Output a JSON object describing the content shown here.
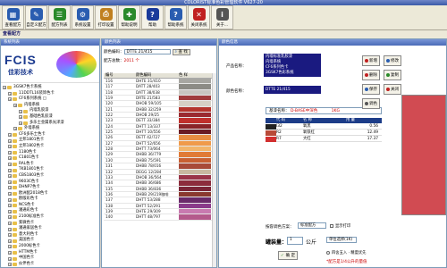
{
  "window": {
    "title": "COLORIST标准色彩管理软件 V627-20"
  },
  "toolbar": [
    {
      "label": "查看配方",
      "color": "#2a5db0",
      "icon": "view"
    },
    {
      "label": "自定义配方",
      "color": "#2a5db0",
      "icon": "custom"
    },
    {
      "label": "配方列表",
      "color": "#2a8a2a",
      "icon": "list"
    },
    {
      "label": "系统设置",
      "color": "#2a5db0",
      "icon": "settings"
    },
    {
      "label": "打印设置",
      "color": "#c08020",
      "icon": "print"
    },
    {
      "label": "帮助说明",
      "color": "#2a8a2a",
      "icon": "help"
    },
    {
      "label": "帮助",
      "color": "#1a3a9a",
      "icon": "question"
    },
    {
      "label": "帮助系统",
      "color": "#2a5db0",
      "icon": "question"
    },
    {
      "label": "关闭系统",
      "color": "#c02020",
      "icon": "close"
    },
    {
      "label": "关于...",
      "color": "#555555",
      "icon": "about"
    }
  ],
  "strip": {
    "title": "查看配方"
  },
  "left": {
    "header": "系统列表",
    "logo_text": "FCIS",
    "logo_sub": "佳彩技术",
    "tree": [
      {
        "indent": 0,
        "label": "3GSK7色卡系统"
      },
      {
        "indent": 1,
        "label": "11DDTL16装饰色卡"
      },
      {
        "indent": 1,
        "label": "CF6系列系统 □"
      },
      {
        "indent": 2,
        "label": "内墙系统"
      },
      {
        "indent": 3,
        "label": "内墙乳胶漆"
      },
      {
        "indent": 3,
        "label": "基础色乳胶漆"
      },
      {
        "indent": 3,
        "label": "多乐士金属系光泽漆"
      },
      {
        "indent": 2,
        "label": "外墙系统"
      },
      {
        "indent": 1,
        "label": "CF6多乐士色卡"
      },
      {
        "indent": 1,
        "label": "立邦1801色卡"
      },
      {
        "indent": 1,
        "label": "立邦1802色卡"
      },
      {
        "indent": 1,
        "label": "1180色卡"
      },
      {
        "indent": 1,
        "label": "C1801色卡"
      },
      {
        "indent": 1,
        "label": "RAL色卡"
      },
      {
        "indent": 1,
        "label": "TKB1801色卡"
      },
      {
        "indent": 1,
        "label": "CBS1803色卡"
      },
      {
        "indent": 1,
        "label": "9603C色卡"
      },
      {
        "indent": 1,
        "label": "DHNP7色卡"
      },
      {
        "indent": 1,
        "label": "欧洲配2018色卡"
      },
      {
        "indent": 1,
        "label": "欧版彩色卡"
      },
      {
        "indent": 1,
        "label": "NCS色卡"
      },
      {
        "indent": 1,
        "label": "潘通彩色卡"
      },
      {
        "indent": 1,
        "label": "2100标准色卡"
      },
      {
        "indent": 1,
        "label": "紫微色卡"
      },
      {
        "indent": 1,
        "label": "潘通家居色卡"
      },
      {
        "indent": 1,
        "label": "意大利色卡"
      },
      {
        "indent": 1,
        "label": "美国色卡"
      },
      {
        "indent": 1,
        "label": "2000标色卡"
      },
      {
        "indent": 1,
        "label": "HTTM色卡"
      },
      {
        "indent": 1,
        "label": "中国色卡"
      },
      {
        "indent": 1,
        "label": "伙伴色卡"
      }
    ]
  },
  "mid": {
    "header": "颜色列表",
    "color_code_label": "颜色编码：",
    "color_code_value": "DTTE 21/415",
    "search_label": "查 找",
    "count_label": "配方总数：",
    "count_value": "2011 个",
    "col1": "编号",
    "col2": "颜色编码",
    "col3": "色 样",
    "rows": [
      {
        "no": "116",
        "code": "DHTE 31/410",
        "color": "#a7a6a2"
      },
      {
        "no": "117",
        "code": "DATT 28/403",
        "color": "#8c8b86"
      },
      {
        "no": "118",
        "code": "DATT 38/038",
        "color": "#c8c6c0"
      },
      {
        "no": "119",
        "code": "DRTE 21/583",
        "color": "#a03c3c"
      },
      {
        "no": "120",
        "code": "DHOB 59/105",
        "color": "#d6d0c4"
      },
      {
        "no": "121",
        "code": "DHBB 32/259",
        "color": "#b4342c"
      },
      {
        "no": "122",
        "code": "DHOB 29/25",
        "color": "#9a2a30"
      },
      {
        "no": "123",
        "code": "DETT 33/384",
        "color": "#c0302c"
      },
      {
        "no": "124",
        "code": "DHTT 13/337",
        "color": "#8a2428"
      },
      {
        "no": "125",
        "code": "DHTT 10/556",
        "color": "#6a1c24"
      },
      {
        "no": "126",
        "code": "DETT 42/727",
        "color": "#e88e42"
      },
      {
        "no": "127",
        "code": "DHTT 52/656",
        "color": "#f09a4a"
      },
      {
        "no": "128",
        "code": "DHTT 73/064",
        "color": "#f2b46a"
      },
      {
        "no": "129",
        "code": "DHBB 36/779",
        "color": "#e07a36"
      },
      {
        "no": "130",
        "code": "DHBB 75/591",
        "color": "#c86032"
      },
      {
        "no": "131",
        "code": "DHBB 78/016",
        "color": "#a84a38"
      },
      {
        "no": "132",
        "code": "DEGG 12/284",
        "color": "#c8b8a0"
      },
      {
        "no": "133",
        "code": "DHOB 36/564",
        "color": "#9a3448"
      },
      {
        "no": "134",
        "code": "DHBB 36/686",
        "color": "#8c2c3c"
      },
      {
        "no": "135",
        "code": "DHBB 36/836",
        "color": "#7a2436"
      },
      {
        "no": "136",
        "code": "DHBB 29/219咖啡",
        "color": "#8a3a30"
      },
      {
        "no": "137",
        "code": "DHTT 53/288",
        "color": "#6a2a6a"
      },
      {
        "no": "138",
        "code": "DHTT 52/291",
        "color": "#8a3a8a"
      },
      {
        "no": "139",
        "code": "DHTE 29/309",
        "color": "#c87ab0"
      },
      {
        "no": "140",
        "code": "DHTT 48/797",
        "color": "#b45a8c"
      }
    ]
  },
  "right": {
    "header": "颜色信息",
    "product_label": "产品名称：",
    "product_lines": [
      "内墙标准乳胶漆",
      "内墙系统",
      "CF6系列色卡",
      "3GSK7色彩系统"
    ],
    "code_label": "颜色名称：",
    "code_value": "DTTE 21/415",
    "base_label": "基漆名称：",
    "base_value": "D-BASE中深色",
    "base_extra": "1KG",
    "formula_cols": [
      "代 码",
      "名 称",
      "用 量"
    ],
    "formula_rows": [
      {
        "code": "I32",
        "name": "氧黑",
        "amount": "0.56",
        "color": "#222222"
      },
      {
        "code": "R2",
        "name": "氧铁红",
        "amount": "12.49",
        "color": "#b84a38"
      },
      {
        "code": "R7",
        "name": "大红",
        "amount": "17.37",
        "color": "#d23030"
      }
    ],
    "buttons": [
      {
        "label": "新增",
        "color": "#c02020"
      },
      {
        "label": "修改",
        "color": "#2a5db0"
      },
      {
        "label": "删除",
        "color": "#c02020"
      },
      {
        "label": "复制",
        "color": "#2a8a2a"
      },
      {
        "label": "保存",
        "color": "#2a5db0"
      },
      {
        "label": "关闭",
        "color": "#c02020"
      },
      {
        "label": "调色",
        "color": "#555555"
      }
    ],
    "calc_label": "按容调色方案：",
    "calc_select": "标准配方",
    "show_print_label": "显示打印",
    "qty_label": "罐装量：",
    "qty_value": "1",
    "unit_label": "公斤",
    "unit_select": "单位选择(1K)",
    "ok_label": "确 定",
    "radio_label": "四舍五入 · 精度优先",
    "note": "*配方是1/4公升的量值",
    "preview_color": "#d14b52"
  }
}
